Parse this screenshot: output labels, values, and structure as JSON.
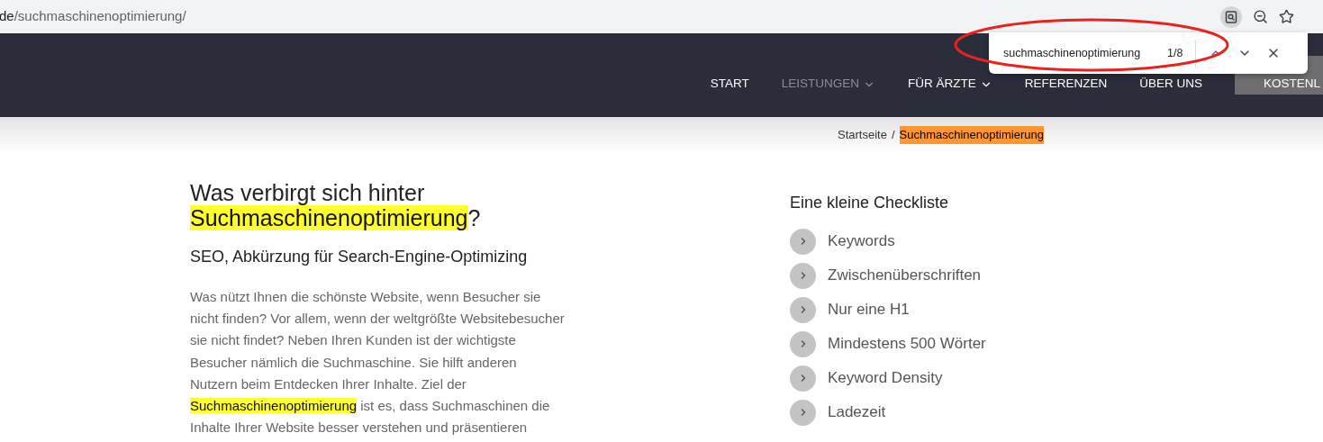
{
  "browser": {
    "url_host": "de",
    "url_path": "/suchmaschinenoptimierung/"
  },
  "nav": {
    "items": [
      {
        "label": "START",
        "selected": false,
        "dropdown": false
      },
      {
        "label": "LEISTUNGEN",
        "selected": true,
        "dropdown": true
      },
      {
        "label": "FÜR ÄRZTE",
        "selected": false,
        "dropdown": true
      },
      {
        "label": "REFERENZEN",
        "selected": false,
        "dropdown": false
      },
      {
        "label": "ÜBER UNS",
        "selected": false,
        "dropdown": false
      }
    ],
    "cta": "KOSTENL"
  },
  "find_bar": {
    "query": "suchmaschinenoptimierung",
    "count": "1/8"
  },
  "breadcrumb": {
    "home": "Startseite",
    "separator": "/",
    "current": "Suchmaschinenoptimierung"
  },
  "article": {
    "title": [
      {
        "text": "Was verbirgt sich hinter ",
        "highlighted": false
      },
      {
        "text": "Suchmaschinenoptimierung",
        "highlighted": true
      },
      {
        "text": "?",
        "highlighted": false
      }
    ],
    "subtitle": "SEO, Abkürzung für Search-Engine-Optimizing",
    "paragraph": [
      {
        "text": "Was nützt Ihnen die schönste Website, wenn Besucher sie nicht finden? Vor allem, wenn der weltgrößte Websitebesucher sie nicht findet? Neben Ihren Kunden ist der wichtigste Besucher nämlich die Suchmaschine. Sie hilft anderen Nutzern beim Entdecken Ihrer Inhalte. Ziel der ",
        "highlighted": false
      },
      {
        "text": "Suchmaschinenoptimierung",
        "highlighted": true
      },
      {
        "text": " ist es, dass Suchmaschinen die Inhalte Ihrer Website besser verstehen und präsentieren",
        "highlighted": false
      }
    ]
  },
  "checklist": {
    "title": "Eine kleine Checkliste",
    "items": [
      "Keywords",
      "Zwischenüberschriften",
      "Nur eine H1",
      "Mindestens 500 Wörter",
      "Keyword Density",
      "Ladezeit"
    ]
  }
}
